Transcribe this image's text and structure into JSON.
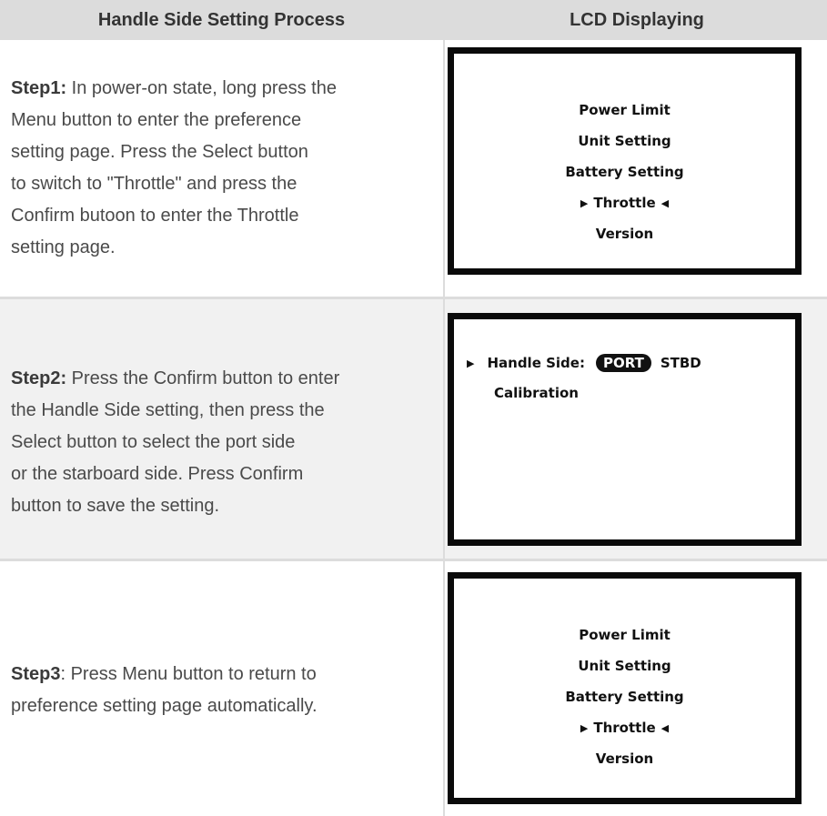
{
  "header": {
    "col1": "Handle Side Setting Process",
    "col2": "LCD Displaying"
  },
  "steps": [
    {
      "label": "Step1:",
      "text": " In power-on state, long press the Menu button to enter the preference setting page. Press the Select button to switch to \"Throttle\" and press the Confirm butoon to enter the Throttle setting page.",
      "lines": [
        " In power-on state, long press the",
        "Menu button to enter the preference",
        "setting page. Press the Select button",
        "to switch to \"Throttle\" and press the",
        "Confirm butoon to enter the Throttle",
        "setting page."
      ]
    },
    {
      "label": "Step2:",
      "lines": [
        " Press the Confirm button to enter",
        "the Handle Side setting, then press the",
        "Select button to select the port side",
        "or the starboard side. Press Confirm",
        "button to save the setting."
      ]
    },
    {
      "label": "Step3",
      "lines": [
        ": Press Menu button to return to",
        "preference setting page automatically."
      ]
    }
  ],
  "lcd1": {
    "items": [
      "Power Limit",
      "Unit Setting",
      "Battery Setting",
      "Throttle",
      "Version"
    ],
    "selected": "Throttle",
    "marker_left": "▶",
    "marker_right": "◀"
  },
  "lcd2": {
    "marker": "▶",
    "label": "Handle Side:",
    "option_selected": "PORT",
    "option_other": "STBD",
    "line2": "Calibration"
  },
  "lcd3": {
    "items": [
      "Power Limit",
      "Unit Setting",
      "Battery Setting",
      "Throttle",
      "Version"
    ],
    "selected": "Throttle",
    "marker_left": "▶",
    "marker_right": "◀"
  }
}
